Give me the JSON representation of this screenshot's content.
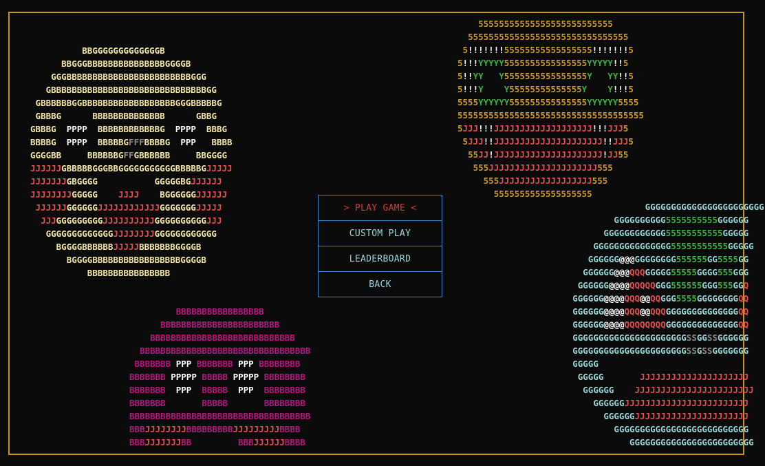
{
  "palette": {
    "frame": "#c8951a",
    "menu_border": "#3a86c8",
    "menu_text": "#9ad6d6",
    "menu_selected": "#d23a3a",
    "glyph_colors": {
      "B_cream": "#f2e6a8",
      "G_cream": "#f2e6a8",
      "J_red": "#e2504f",
      "P_white": "#ffffff",
      "F_gray": "#8a8a8a",
      "5_gold": "#c99a2e",
      "!_white": "#ffffff",
      "Y_green": "#3cb043",
      "B_magenta": "#b0187c",
      "G_cyan": "#9ad6d6",
      "5_green": "#3cb043",
      "@_white": "#ffffff",
      "Q_red": "#e2504f",
      "S_gray": "#8a8a8a"
    }
  },
  "menu": {
    "items": [
      {
        "label": "> PLAY GAME <",
        "selected": true
      },
      {
        "label": "CUSTOM PLAY",
        "selected": false
      },
      {
        "label": "LEADERBOARD",
        "selected": false
      },
      {
        "label": "BACK",
        "selected": false
      }
    ]
  },
  "art": {
    "top_left_face": {
      "legend": {
        "B": "B_cream",
        "G": "G_cream",
        "J": "J_red",
        "P": "P_white",
        "F": "F_gray"
      },
      "lines": [
        "          BBGGGGGGGGGGGGGB",
        "      BBGGGBBBBBBBBBBBBBBBGGGGB",
        "    GGGBBBBBBBBBBBBBBBBBBBBBBBBGGG",
        "   GBBBBBBBBBBBBBBBBBBBBBBBBBBBBBBGG",
        " GBBBBBBGGBBBBBBBBBBBBBBBBBBGGGBBBBBG",
        " GBBBG      BBBBBBBBBBBBBB      GBBG",
        "GBBBG  PPPP  BBBBBBBBBBBBG  PPPP  BBBG",
        "BBBBG  PPPP  BBBBBGFFFBBBBG  PPP   BBBB",
        "GGGGBB     BBBBBBGFFGBBBBBB     BBGGGG",
        "JJJJJJGBBBBBGGGBBGGGGGGGGGGGBBBBBGJJJJJ",
        "JJJJJJJGBGGGG           GGGGGBGJJJJJJ",
        "JJJJJJJJGGGGG    JJJJ    BGGGGGGJJJJJJ",
        " JJJJJJGGGGGGJJJJJJJJJJJJGGGGGGGJJJJJ",
        "  JJJGGGGGGGGGJJJJJJJJJJGGGGGGGGGGJJJ",
        "   GGGGGGGGGGGGGJJJJJJJJGGGGGGGGGGGG",
        "     BGGGGBBBBBBJJJJJBBBBBBBGGGGB",
        "       BGGGGBBBBBBBBBBBBBBBBBGGGGB",
        "           BBBBBBBBBBBBBBBB"
      ]
    },
    "top_right_face": {
      "legend": {
        "5": "5_gold",
        "!": "!_white",
        "Y": "Y_green",
        "J": "J_red"
      },
      "lines": [
        "    55555555555555555555555555",
        "  5555555555555555555555555555555",
        " 5!!!!!!!55555555555555555!!!!!!!5",
        "5!!!YYYYY5555555555555555YYYYY!!5",
        "5!!YY   Y5555555555555555Y   YY!!5",
        "5!!!Y    Y55555555555555Y    Y!!!5",
        "5555YYYYYY555555555555555YYYYYY5555",
        "555555555555555555555555555555555555",
        "5JJJ!!!JJJJJJJJJJJJJJJJJJJ!!!JJJ5",
        " 5JJJ!!JJJJJJJJJJJJJJJJJJJJJ!!JJJ5",
        "  55JJ!JJJJJJJJJJJJJJJJJJJJJ!JJ55",
        "   555JJJJJJJJJJJJJJJJJJJJJ555",
        "     555JJJJJJJJJJJJJJJJJJ555",
        "       5555555555555555555"
      ]
    },
    "bottom_center_face": {
      "legend": {
        "B": "B_magenta",
        "J": "J_red",
        "P": "P_white"
      },
      "lines": [
        "         BBBBBBBBBBBBBBBBB",
        "      BBBBBBBBBBBBBBBBBBBBBBB",
        "    BBBBBBBBBBBBBBBBBBBBBBBBBBBB",
        "  BBBBBBBBBBBBBBBBBBBBBBBBBBBBBBBBB",
        " BBBBBBB PPP BBBBBBB PPP BBBBBBBB",
        "BBBBBBB PPPPP BBBBB PPPPP BBBBBBBB",
        "BBBBBBB  PPP  BBBBB  PPP  BBBBBBBB",
        "BBBBBBB       BBBBB       BBBBBBBB",
        "BBBBBBBBBBBBBBBBBBBBBBBBBBBBBBBBBBB",
        "BBBJJJJJJJJBBBBBBBBBJJJJJJJJJBBBB",
        "BBBJJJJJJJBB         BBBJJJJJJBBBB"
      ]
    },
    "bottom_right_face": {
      "legend": {
        "G": "G_cyan",
        "5": "5_green",
        "@": "@_white",
        "Q": "Q_red",
        "S": "S_gray",
        "J": "J_red"
      },
      "lines": [
        "                      GGGGGGGGGGGGGGGGGGGGGGG",
        "                GGGGGGGGGG5555555555GGGGGG",
        "              GGGGGGGGGGGG55555555555GGGGG",
        "            GGGGGGGGGGGGGGG55555555555GGGGG",
        "           GGGGGG@@@GGGGGGGG555555GG5555GG",
        "          GGGGGG@@@QQQGGGGG55555GGGG555GGG",
        "         GGGGGG@@@@QQQQQGGG555555GGG555GGQ",
        "        GGGGGG@@@@QQQ@@QQGGG5555GGGGGGGGQQ",
        "        GGGGGG@@@@QQQ@@QQQGGGGGGGGGGGGGGQQ",
        "        GGGGGG@@@@QQQQQQQQGGGGGGGGGGGGGGQQ",
        "        GGGGGGGGGGGGGGGGGGGGGGSSGGSSGGGGGG",
        "        GGGGGGGGGGGGGGGGGGGGGGSSGSSGGGGGGG",
        "        GGGGG",
        "         GGGGG       JJJJJJJJJJJJJJJJJJJJJ",
        "          GGGGGG    JJJJJJJJJJJJJJJJJJJJJJJ",
        "            GGGGGGJJJJJJJJJJJJJJJJJJJJJJJJ",
        "              GGGGGGJJJJJJJJJJJJJJJJJJJJJJ",
        "                GGGGGGGGGGGGGGGGGGGGGGGGGG",
        "                   GGGGGGGGGGGGGGGGGGGGGGGG"
      ]
    }
  }
}
